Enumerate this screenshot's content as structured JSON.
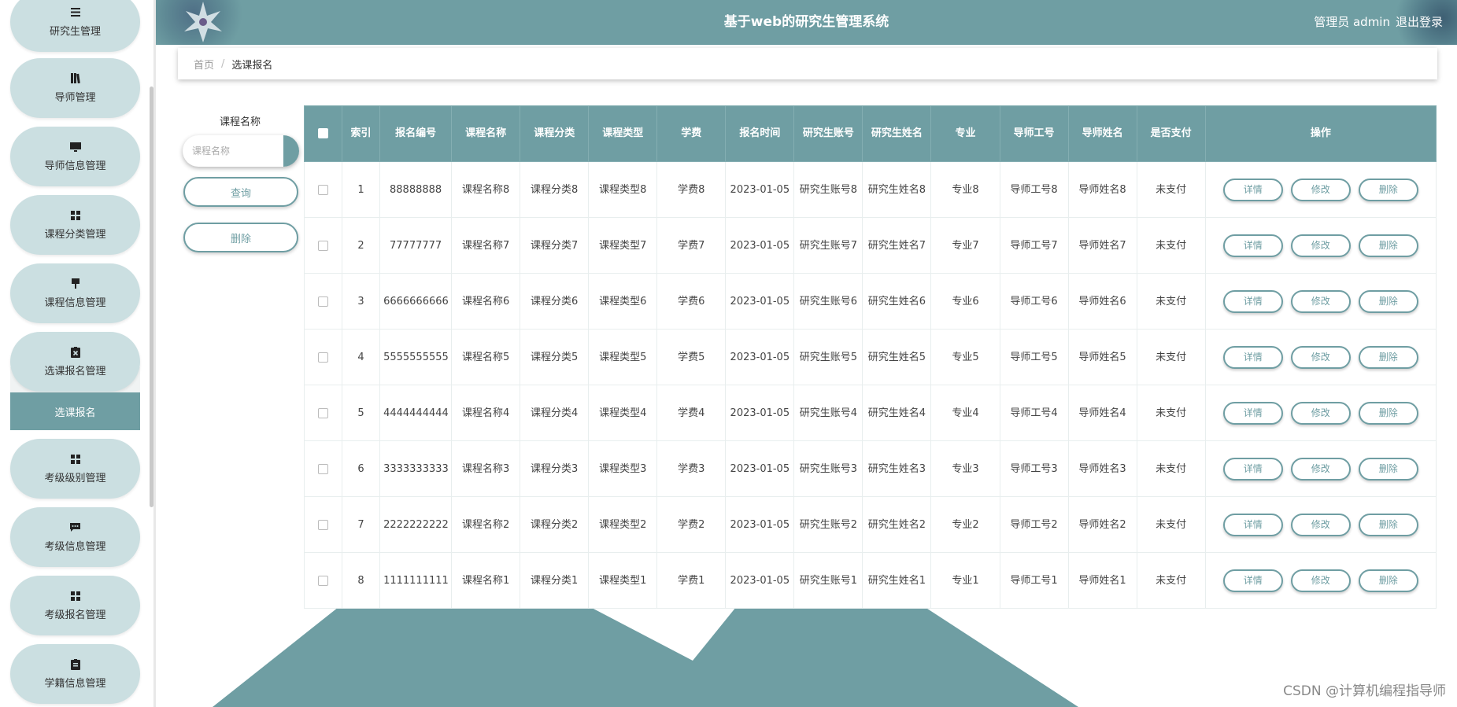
{
  "colors": {
    "accent": "#6f9ea3",
    "nav_bg": "#cbdfe1",
    "header_bg": "#6f9ea3"
  },
  "header": {
    "title": "基于web的研究生管理系统",
    "user": "管理员 admin",
    "logout": "退出登录"
  },
  "sidebar": {
    "items": [
      {
        "label": "研究生管理",
        "icon": "list-icon"
      },
      {
        "label": "导师管理",
        "icon": "book-icon"
      },
      {
        "label": "导师信息管理",
        "icon": "monitor-icon"
      },
      {
        "label": "课程分类管理",
        "icon": "grid-icon"
      },
      {
        "label": "课程信息管理",
        "icon": "pin-icon"
      },
      {
        "label": "选课报名管理",
        "icon": "clipboard-x-icon"
      },
      {
        "label": "考级级别管理",
        "icon": "grid-icon"
      },
      {
        "label": "考级信息管理",
        "icon": "chat-icon"
      },
      {
        "label": "考级报名管理",
        "icon": "grid-icon"
      },
      {
        "label": "学籍信息管理",
        "icon": "clipboard-icon"
      }
    ],
    "active_sub": "选课报名"
  },
  "breadcrumb": {
    "home": "首页",
    "separator": "/",
    "current": "选课报名"
  },
  "search": {
    "label": "课程名称",
    "placeholder": "课程名称",
    "query_button": "查询",
    "delete_button": "删除"
  },
  "table": {
    "headers": [
      "索引",
      "报名编号",
      "课程名称",
      "课程分类",
      "课程类型",
      "学费",
      "报名时间",
      "研究生账号",
      "研究生姓名",
      "专业",
      "导师工号",
      "导师姓名",
      "是否支付",
      "操作"
    ],
    "actions": {
      "detail": "详情",
      "edit": "修改",
      "delete": "删除"
    },
    "rows": [
      {
        "index": "1",
        "code": "88888888",
        "course": "课程名称8",
        "category": "课程分类8",
        "type": "课程类型8",
        "fee": "学费8",
        "time": "2023-01-05",
        "account": "研究生账号8",
        "name": "研究生姓名8",
        "major": "专业8",
        "tutor_id": "导师工号8",
        "tutor_name": "导师姓名8",
        "paid": "未支付"
      },
      {
        "index": "2",
        "code": "77777777",
        "course": "课程名称7",
        "category": "课程分类7",
        "type": "课程类型7",
        "fee": "学费7",
        "time": "2023-01-05",
        "account": "研究生账号7",
        "name": "研究生姓名7",
        "major": "专业7",
        "tutor_id": "导师工号7",
        "tutor_name": "导师姓名7",
        "paid": "未支付"
      },
      {
        "index": "3",
        "code": "6666666666",
        "course": "课程名称6",
        "category": "课程分类6",
        "type": "课程类型6",
        "fee": "学费6",
        "time": "2023-01-05",
        "account": "研究生账号6",
        "name": "研究生姓名6",
        "major": "专业6",
        "tutor_id": "导师工号6",
        "tutor_name": "导师姓名6",
        "paid": "未支付"
      },
      {
        "index": "4",
        "code": "5555555555",
        "course": "课程名称5",
        "category": "课程分类5",
        "type": "课程类型5",
        "fee": "学费5",
        "time": "2023-01-05",
        "account": "研究生账号5",
        "name": "研究生姓名5",
        "major": "专业5",
        "tutor_id": "导师工号5",
        "tutor_name": "导师姓名5",
        "paid": "未支付"
      },
      {
        "index": "5",
        "code": "4444444444",
        "course": "课程名称4",
        "category": "课程分类4",
        "type": "课程类型4",
        "fee": "学费4",
        "time": "2023-01-05",
        "account": "研究生账号4",
        "name": "研究生姓名4",
        "major": "专业4",
        "tutor_id": "导师工号4",
        "tutor_name": "导师姓名4",
        "paid": "未支付"
      },
      {
        "index": "6",
        "code": "3333333333",
        "course": "课程名称3",
        "category": "课程分类3",
        "type": "课程类型3",
        "fee": "学费3",
        "time": "2023-01-05",
        "account": "研究生账号3",
        "name": "研究生姓名3",
        "major": "专业3",
        "tutor_id": "导师工号3",
        "tutor_name": "导师姓名3",
        "paid": "未支付"
      },
      {
        "index": "7",
        "code": "2222222222",
        "course": "课程名称2",
        "category": "课程分类2",
        "type": "课程类型2",
        "fee": "学费2",
        "time": "2023-01-05",
        "account": "研究生账号2",
        "name": "研究生姓名2",
        "major": "专业2",
        "tutor_id": "导师工号2",
        "tutor_name": "导师姓名2",
        "paid": "未支付"
      },
      {
        "index": "8",
        "code": "1111111111",
        "course": "课程名称1",
        "category": "课程分类1",
        "type": "课程类型1",
        "fee": "学费1",
        "time": "2023-01-05",
        "account": "研究生账号1",
        "name": "研究生姓名1",
        "major": "专业1",
        "tutor_id": "导师工号1",
        "tutor_name": "导师姓名1",
        "paid": "未支付"
      }
    ]
  },
  "watermark": "CSDN @计算机编程指导师"
}
